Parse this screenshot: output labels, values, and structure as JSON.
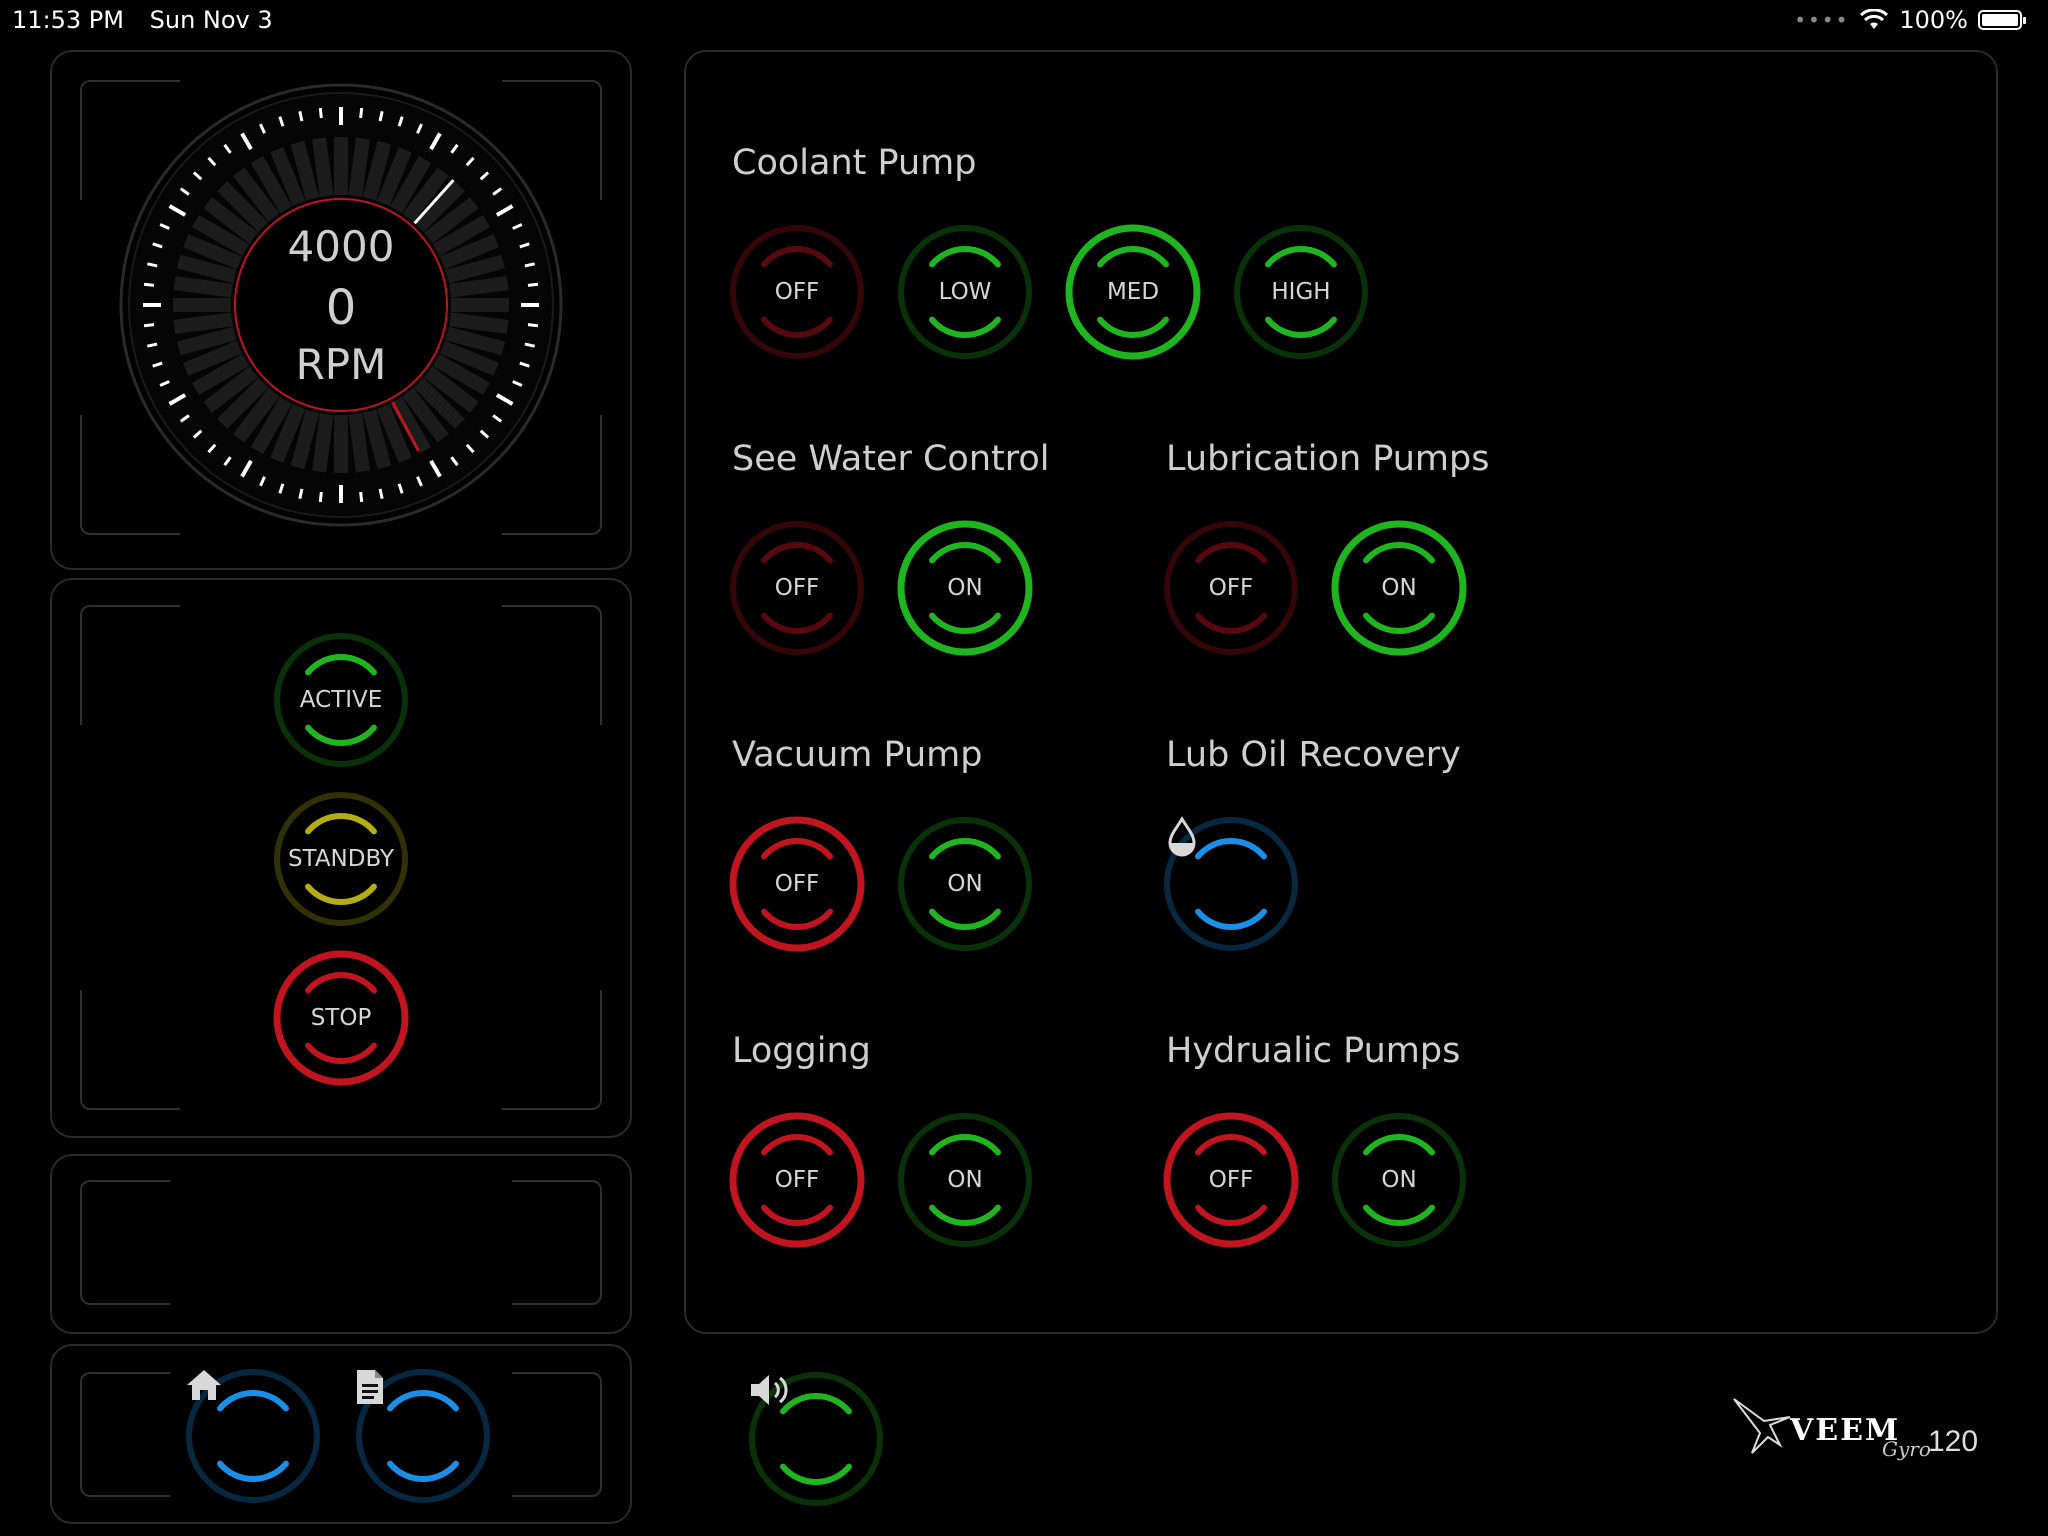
{
  "status_bar": {
    "time": "11:53 PM",
    "date": "Sun Nov 3",
    "battery": "100%"
  },
  "gauge": {
    "max_label": "4000",
    "value": "0",
    "unit": "RPM",
    "needle_value": 0
  },
  "state_buttons": [
    {
      "label": "ACTIVE",
      "color": "#1fb51f",
      "dim": true
    },
    {
      "label": "STANDBY",
      "color": "#b3ac12",
      "dim": true
    },
    {
      "label": "STOP",
      "color": "#c0141e",
      "dim": false
    }
  ],
  "nav_buttons": {
    "home_icon": "home-icon",
    "document_icon": "document-icon",
    "color": "#1a8fe8"
  },
  "sound_button": {
    "icon": "speaker-icon",
    "color": "#1fb51f"
  },
  "groups": {
    "coolant": {
      "title": "Coolant Pump",
      "buttons": [
        "OFF",
        "LOW",
        "MED",
        "HIGH"
      ],
      "selected": "MED"
    },
    "sea_water": {
      "title": "See Water Control",
      "buttons": [
        "OFF",
        "ON"
      ],
      "selected": "ON"
    },
    "lubrication": {
      "title": "Lubrication Pumps",
      "buttons": [
        "OFF",
        "ON"
      ],
      "selected": "ON"
    },
    "vacuum": {
      "title": "Vacuum Pump",
      "buttons": [
        "OFF",
        "ON"
      ],
      "selected": "OFF"
    },
    "lub_oil": {
      "title": "Lub Oil Recovery",
      "icon": "oil-drop-icon"
    },
    "logging": {
      "title": "Logging",
      "buttons": [
        "OFF",
        "ON"
      ],
      "selected": "OFF"
    },
    "hydraulic": {
      "title": "Hydrualic Pumps",
      "buttons": [
        "OFF",
        "ON"
      ],
      "selected": "OFF"
    }
  },
  "colors": {
    "red": "#c0141e",
    "green": "#1fb51f",
    "blue": "#1a8fe8",
    "yellow": "#b3ac12"
  },
  "logo": {
    "brand": "VEEM",
    "script": "Gyro",
    "model": "120"
  }
}
